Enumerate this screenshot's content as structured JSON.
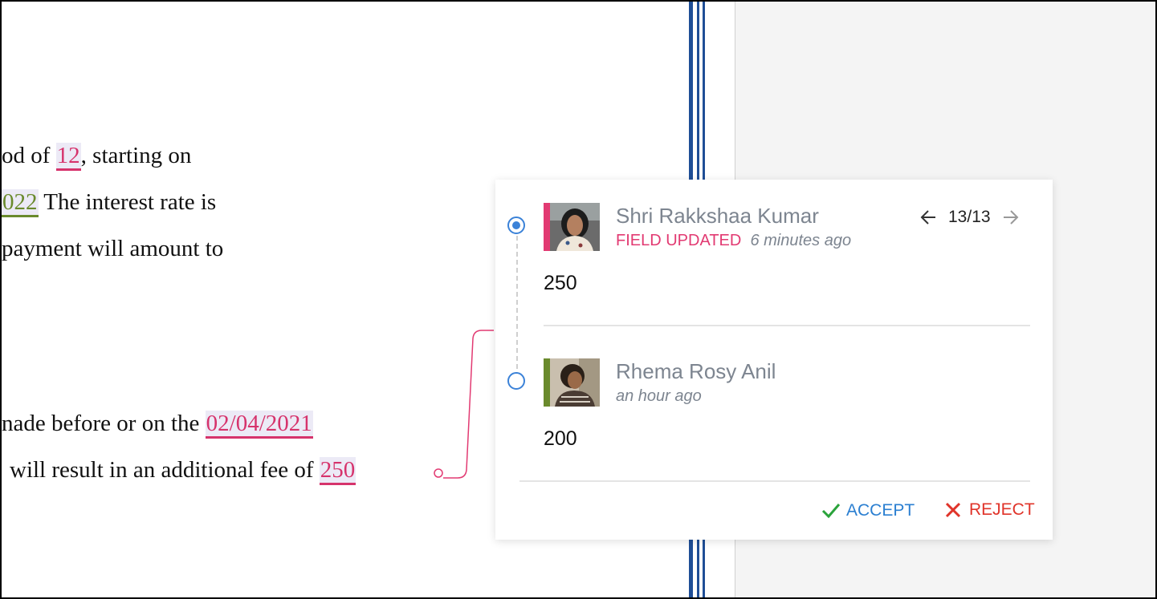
{
  "document": {
    "line1": {
      "before": "od of ",
      "field": "12",
      "after": ", starting on"
    },
    "line2": {
      "field": "022",
      "after": " The interest rate is"
    },
    "line3": {
      "text": "payment will amount to"
    },
    "line4": {
      "before": "nade before or on the ",
      "field": "02/04/2021"
    },
    "line5": {
      "before": "will result in an additional fee of ",
      "field": "250"
    }
  },
  "popup": {
    "pager": {
      "position": "13/13"
    },
    "entries": [
      {
        "author": "Shri Rakkshaa Kumar",
        "status": "FIELD UPDATED",
        "time": "6 minutes ago",
        "value": "250",
        "stripe_color": "#e23a72",
        "selected": true
      },
      {
        "author": "Rhema Rosy Anil",
        "status": "",
        "time": "an hour ago",
        "value": "200",
        "stripe_color": "#6a8a2c",
        "selected": false
      }
    ],
    "actions": {
      "accept": "ACCEPT",
      "reject": "REJECT"
    }
  },
  "colors": {
    "accent_blue": "#3b82d8",
    "field_pink": "#d6336c",
    "field_green": "#6a8a2c",
    "reject_red": "#e0342a",
    "accept_check": "#2aa33b"
  }
}
